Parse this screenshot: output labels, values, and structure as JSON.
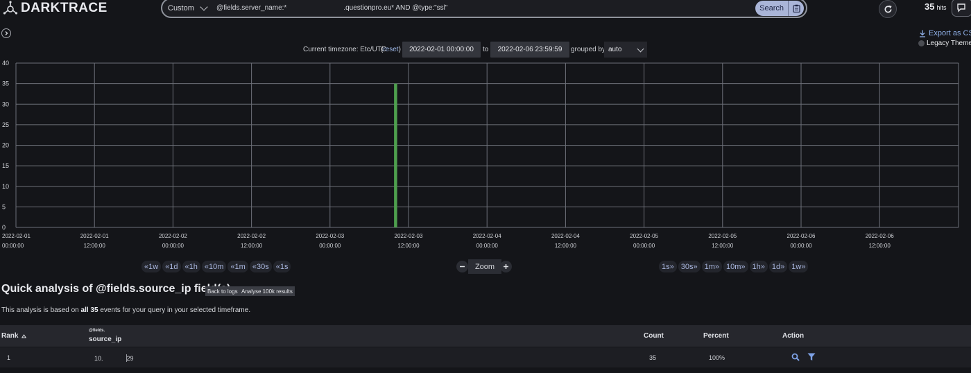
{
  "header": {
    "brand": "DARKTRACE",
    "search": {
      "mode": "Custom",
      "query_part1": "@fields.server_name:*",
      "query_part2": ".questionpro.eu* AND @type:\"ssl\"",
      "button_label": "Search"
    },
    "hits_count": "35",
    "hits_label": "hits"
  },
  "toolbar": {
    "export_label": "Export as CS",
    "legacy_theme_label": "Legacy Theme"
  },
  "time_controls": {
    "timezone_label": "Current timezone: Etc/UTC",
    "reset_label": "reset",
    "from": "2022-02-01 00:00:00",
    "to_label": "to",
    "to": "2022-02-06 23:59:59",
    "grouped_by_label": "grouped by",
    "grouped_by_value": "auto"
  },
  "chart_data": {
    "type": "bar",
    "x_range": [
      "2022-02-01 00:00",
      "2022-02-06 23:59:59"
    ],
    "x_ticks": [
      {
        "date": "2022-02-01",
        "time": "00:00:00",
        "hours": 0
      },
      {
        "date": "2022-02-01",
        "time": "12:00:00",
        "hours": 12
      },
      {
        "date": "2022-02-02",
        "time": "00:00:00",
        "hours": 24
      },
      {
        "date": "2022-02-02",
        "time": "12:00:00",
        "hours": 36
      },
      {
        "date": "2022-02-03",
        "time": "00:00:00",
        "hours": 48
      },
      {
        "date": "2022-02-03",
        "time": "12:00:00",
        "hours": 60
      },
      {
        "date": "2022-02-04",
        "time": "00:00:00",
        "hours": 72
      },
      {
        "date": "2022-02-04",
        "time": "12:00:00",
        "hours": 84
      },
      {
        "date": "2022-02-05",
        "time": "00:00:00",
        "hours": 96
      },
      {
        "date": "2022-02-05",
        "time": "12:00:00",
        "hours": 108
      },
      {
        "date": "2022-02-06",
        "time": "00:00:00",
        "hours": 120
      },
      {
        "date": "2022-02-06",
        "time": "12:00:00",
        "hours": 132
      }
    ],
    "ylim": [
      0,
      40
    ],
    "y_ticks": [
      0,
      5,
      10,
      15,
      20,
      25,
      30,
      35,
      40
    ],
    "bars": [
      {
        "time": "2022-02-03 10:00",
        "hours": 58,
        "value": 35
      }
    ],
    "bar_color": "#4ea04e",
    "grid": true
  },
  "nav": {
    "back": [
      "1w",
      "1d",
      "1h",
      "10m",
      "1m",
      "30s",
      "1s"
    ],
    "forward": [
      "1s",
      "30s",
      "1m",
      "10m",
      "1h",
      "1d",
      "1w"
    ],
    "zoom_label": "Zoom"
  },
  "analysis": {
    "title": "Quick analysis of @fields.source_ip field(s)",
    "back_button": "Back to logs",
    "analyse_button": "Analyse 100k results",
    "desc_pre": "This analysis is based on",
    "desc_bold": "all 35",
    "desc_post": "events for your query in your selected timeframe."
  },
  "table": {
    "headers": {
      "rank": "Rank",
      "field_prefix": "@fields.",
      "field": "source_ip",
      "count": "Count",
      "percent": "Percent",
      "action": "Action"
    },
    "rows": [
      {
        "rank": "1",
        "ip_start": "10.",
        "ip_end": "29",
        "count": "35",
        "percent": "100%"
      }
    ]
  },
  "colors": {
    "background": "#141519",
    "accent": "#aab5d8",
    "link": "#8fb0e8",
    "bar": "#4ea04e"
  }
}
